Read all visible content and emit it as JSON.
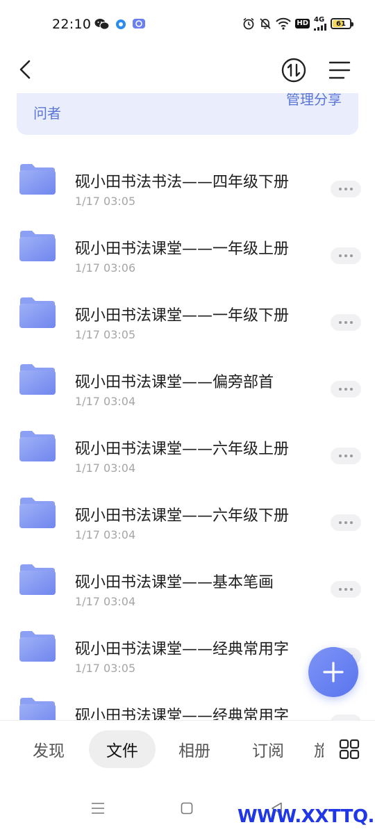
{
  "status_bar": {
    "time": "22:10",
    "battery": "61",
    "battery_level": 0.61,
    "network": "4G",
    "hd": "HD",
    "left_icons": [
      "wechat-icon",
      "app-dot-icon",
      "mail-app-icon"
    ],
    "right_icons": [
      "alarm-icon",
      "mute-bell-icon",
      "wifi-icon",
      "hd-icon",
      "signal-icon",
      "battery-icon"
    ]
  },
  "nav": {
    "back_icon": "chevron-left-icon",
    "sort_icon": "sort-arrows-icon",
    "menu_icon": "menu-lines-icon"
  },
  "banner": {
    "left_text": "问者",
    "right_text": "管理分享"
  },
  "files": [
    {
      "name": "砚小田书法书法——四年级下册",
      "date": "1/17 03:05"
    },
    {
      "name": "砚小田书法课堂——一年级上册",
      "date": "1/17 03:06"
    },
    {
      "name": "砚小田书法课堂——一年级下册",
      "date": "1/17 03:05"
    },
    {
      "name": "砚小田书法课堂——偏旁部首",
      "date": "1/17 03:04"
    },
    {
      "name": "砚小田书法课堂——六年级上册",
      "date": "1/17 03:04"
    },
    {
      "name": "砚小田书法课堂——六年级下册",
      "date": "1/17 03:04"
    },
    {
      "name": "砚小田书法课堂——基本笔画",
      "date": "1/17 03:04"
    },
    {
      "name": "砚小田书法课堂——经典常用字",
      "date": "1/17 03:05"
    },
    {
      "name": "砚小田书法课堂——经典常用字",
      "date": ""
    }
  ],
  "tabs": [
    {
      "label": "发现",
      "active": false
    },
    {
      "label": "文件",
      "active": true
    },
    {
      "label": "相册",
      "active": false
    },
    {
      "label": "订阅",
      "active": false
    },
    {
      "label": "旅",
      "active": false
    }
  ],
  "fab_icon": "plus-icon",
  "grid_icon": "grid-icon",
  "system_nav": [
    "recents-icon",
    "home-icon",
    "back-triangle-icon"
  ],
  "watermark": "WWW.XXTTQ.COM",
  "colors": {
    "accent": "#5a74ee",
    "banner_bg": "#e9edfc",
    "banner_text": "#5b76d8",
    "folder_top": "#9fb0f7",
    "folder_bottom": "#6f86ee",
    "watermark": "#1f37e6"
  }
}
